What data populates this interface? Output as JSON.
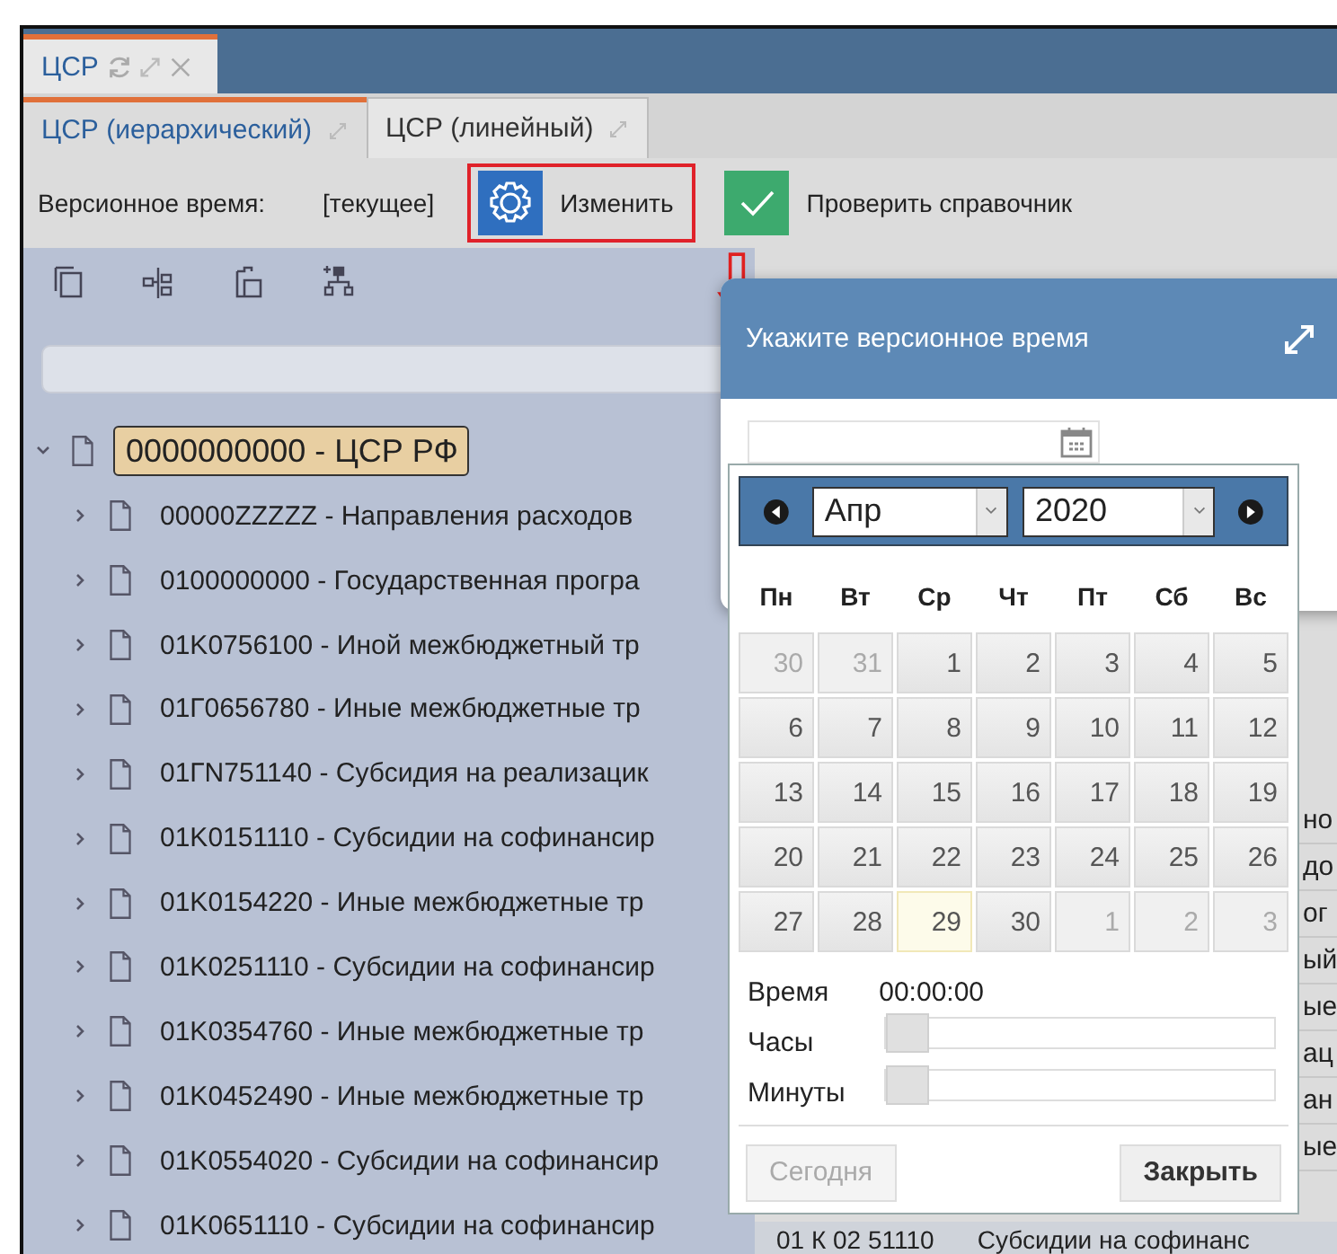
{
  "main_tab": {
    "label": "ЦСР"
  },
  "tabs": [
    {
      "label": "ЦСР (иерархический)",
      "selected": true
    },
    {
      "label": "ЦСР (линейный)",
      "selected": false
    }
  ],
  "toolbar": {
    "version_label": "Версионное время:",
    "version_value": "[текущее]",
    "change_button": "Изменить",
    "check_button": "Проверить справочник"
  },
  "tree": {
    "label": "0000000000 - ЦСР РФ",
    "expanded": true,
    "selected": true,
    "children": [
      {
        "label": "00000ZZZZZ - Направления расходов",
        "expanded": false,
        "selected": false
      },
      {
        "label": "0100000000 - Государственная програ",
        "expanded": false,
        "selected": false
      },
      {
        "label": "01K0756100 - Иной межбюджетный тр",
        "expanded": false,
        "selected": false
      },
      {
        "label": "01Г0656780 - Иные межбюджетные тр",
        "expanded": false,
        "selected": false
      },
      {
        "label": "01ГN751140 - Субсидия на реализацик",
        "expanded": false,
        "selected": false
      },
      {
        "label": "01K0151110 - Субсидии на софинансир",
        "expanded": false,
        "selected": false
      },
      {
        "label": "01K0154220 - Иные межбюджетные тр",
        "expanded": false,
        "selected": false
      },
      {
        "label": "01K0251110 - Субсидии на софинансир",
        "expanded": false,
        "selected": false
      },
      {
        "label": "01K0354760 - Иные межбюджетные тр",
        "expanded": false,
        "selected": false
      },
      {
        "label": "01K0452490 - Иные межбюджетные тр",
        "expanded": false,
        "selected": false
      },
      {
        "label": "01K0554020 - Субсидии на софинансир",
        "expanded": false,
        "selected": false
      },
      {
        "label": "01K0651110 - Субсидии на софинансир",
        "expanded": false,
        "selected": false
      }
    ]
  },
  "background_rows": [
    "но",
    "до",
    "ог",
    "ый",
    "ые",
    "ац",
    "ан",
    "ые"
  ],
  "bottom_row": {
    "code": "01 К 02 51110",
    "name": "Субсидии на софинанс"
  },
  "dialog": {
    "title": "Укажите версионное время"
  },
  "calendar": {
    "month": "Апр",
    "year": "2020",
    "weekdays": [
      "Пн",
      "Вт",
      "Ср",
      "Чт",
      "Пт",
      "Сб",
      "Вс"
    ],
    "weeks": [
      [
        {
          "label": "30",
          "other_month": true,
          "today": false
        },
        {
          "label": "31",
          "other_month": true,
          "today": false
        },
        {
          "label": "1",
          "other_month": false,
          "today": false
        },
        {
          "label": "2",
          "other_month": false,
          "today": false
        },
        {
          "label": "3",
          "other_month": false,
          "today": false
        },
        {
          "label": "4",
          "other_month": false,
          "today": false
        },
        {
          "label": "5",
          "other_month": false,
          "today": false
        }
      ],
      [
        {
          "label": "6",
          "other_month": false,
          "today": false
        },
        {
          "label": "7",
          "other_month": false,
          "today": false
        },
        {
          "label": "8",
          "other_month": false,
          "today": false
        },
        {
          "label": "9",
          "other_month": false,
          "today": false
        },
        {
          "label": "10",
          "other_month": false,
          "today": false
        },
        {
          "label": "11",
          "other_month": false,
          "today": false
        },
        {
          "label": "12",
          "other_month": false,
          "today": false
        }
      ],
      [
        {
          "label": "13",
          "other_month": false,
          "today": false
        },
        {
          "label": "14",
          "other_month": false,
          "today": false
        },
        {
          "label": "15",
          "other_month": false,
          "today": false
        },
        {
          "label": "16",
          "other_month": false,
          "today": false
        },
        {
          "label": "17",
          "other_month": false,
          "today": false
        },
        {
          "label": "18",
          "other_month": false,
          "today": false
        },
        {
          "label": "19",
          "other_month": false,
          "today": false
        }
      ],
      [
        {
          "label": "20",
          "other_month": false,
          "today": false
        },
        {
          "label": "21",
          "other_month": false,
          "today": false
        },
        {
          "label": "22",
          "other_month": false,
          "today": false
        },
        {
          "label": "23",
          "other_month": false,
          "today": false
        },
        {
          "label": "24",
          "other_month": false,
          "today": false
        },
        {
          "label": "25",
          "other_month": false,
          "today": false
        },
        {
          "label": "26",
          "other_month": false,
          "today": false
        }
      ],
      [
        {
          "label": "27",
          "other_month": false,
          "today": false
        },
        {
          "label": "28",
          "other_month": false,
          "today": false
        },
        {
          "label": "29",
          "other_month": false,
          "today": true
        },
        {
          "label": "30",
          "other_month": false,
          "today": false
        },
        {
          "label": "1",
          "other_month": true,
          "today": false
        },
        {
          "label": "2",
          "other_month": true,
          "today": false
        },
        {
          "label": "3",
          "other_month": true,
          "today": false
        }
      ]
    ]
  },
  "time": {
    "label": "Время",
    "value": "00:00:00",
    "sliders": [
      {
        "label": "Часы",
        "level": 0
      },
      {
        "label": "Минуты",
        "level": 0
      }
    ]
  },
  "buttons": [
    {
      "label": "Сегодня",
      "disabled": true
    },
    {
      "label": "Закрыть",
      "disabled": false
    }
  ]
}
